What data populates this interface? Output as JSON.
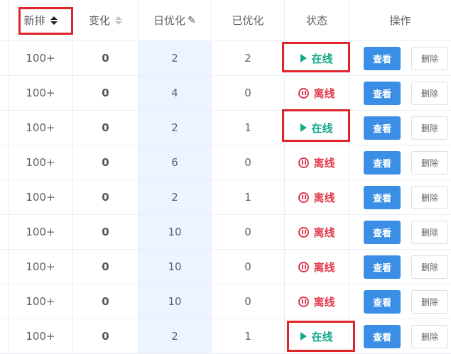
{
  "header": {
    "col_new_rank": "新排",
    "col_change": "变化",
    "col_daily_opt": "日优化",
    "col_optimized": "已优化",
    "col_status": "状态",
    "col_action": "操作"
  },
  "labels": {
    "online": "在线",
    "offline": "离线",
    "view": "查看",
    "delete": "删除"
  },
  "rows": [
    {
      "new_rank": "100+",
      "change": "0",
      "daily": "2",
      "done": "2",
      "status": "在线"
    },
    {
      "new_rank": "100+",
      "change": "0",
      "daily": "4",
      "done": "0",
      "status": "离线"
    },
    {
      "new_rank": "100+",
      "change": "0",
      "daily": "2",
      "done": "1",
      "status": "在线"
    },
    {
      "new_rank": "100+",
      "change": "0",
      "daily": "6",
      "done": "0",
      "status": "离线"
    },
    {
      "new_rank": "100+",
      "change": "0",
      "daily": "2",
      "done": "1",
      "status": "离线"
    },
    {
      "new_rank": "100+",
      "change": "0",
      "daily": "10",
      "done": "0",
      "status": "离线"
    },
    {
      "new_rank": "100+",
      "change": "0",
      "daily": "10",
      "done": "0",
      "status": "离线"
    },
    {
      "new_rank": "100+",
      "change": "0",
      "daily": "10",
      "done": "0",
      "status": "离线"
    },
    {
      "new_rank": "100+",
      "change": "0",
      "daily": "2",
      "done": "1",
      "status": "在线"
    }
  ],
  "colors": {
    "online": "#13a888",
    "offline": "#e2384a",
    "primary": "#3a8ee6",
    "highlight": "#e0242b",
    "edit_col_bg": "#ecf5ff"
  }
}
